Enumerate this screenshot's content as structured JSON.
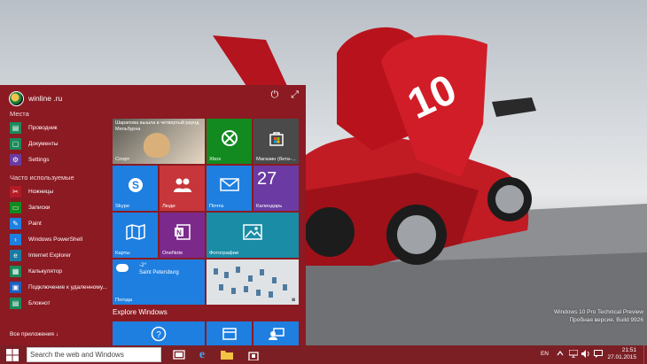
{
  "desktop": {
    "watermark_line1": "Windows 10 Pro Technical Preview",
    "watermark_line2": "Пробная версия. Build 9926"
  },
  "start_menu": {
    "user_name": "winline .ru",
    "places_heading": "Места",
    "places": [
      {
        "label": "Проводник",
        "icon": "file-explorer-icon"
      },
      {
        "label": "Документы",
        "icon": "documents-icon"
      },
      {
        "label": "Settings",
        "icon": "settings-icon"
      }
    ],
    "most_used_heading": "Часто используемые",
    "most_used": [
      {
        "label": "Ножницы",
        "icon": "snipping-tool-icon"
      },
      {
        "label": "Записки",
        "icon": "sticky-notes-icon"
      },
      {
        "label": "Paint",
        "icon": "paint-icon"
      },
      {
        "label": "Windows PowerShell",
        "icon": "powershell-icon"
      },
      {
        "label": "Internet Explorer",
        "icon": "internet-explorer-icon"
      },
      {
        "label": "Калькулятор",
        "icon": "calculator-icon"
      },
      {
        "label": "Подключение к удаленному...",
        "icon": "remote-desktop-icon"
      },
      {
        "label": "Блокнот",
        "icon": "notepad-icon"
      }
    ],
    "all_apps": "Все приложения",
    "all_apps_arrow": "↓",
    "explore": "Explore Windows",
    "tiles": {
      "sport_headline": "Шарапова вышла в четвертый раунд Мельбурна",
      "sport_label": "Спорт",
      "xbox": "Xbox",
      "store": "Магазин (бета-...",
      "skype": "Skype",
      "people": "Люди",
      "mail": "Почта",
      "calendar_day": "27",
      "calendar": "Календарь",
      "maps": "Карты",
      "onenote": "OneNote",
      "photos": "Фотографии",
      "weather_temp": "-2°",
      "weather_city": "Saint Petersburg",
      "weather": "Погода"
    }
  },
  "taskbar": {
    "search_placeholder": "Search the web and Windows",
    "language": "EN",
    "time": "21:51",
    "date": "27.01.2015"
  },
  "colors": {
    "accent": "#8b1a22",
    "taskbar": "#7b1f25",
    "tile_blue": "#1e7fe0",
    "tile_green": "#138a1f",
    "tile_purple": "#6b3ba3",
    "tile_teal": "#1a8ca6"
  }
}
